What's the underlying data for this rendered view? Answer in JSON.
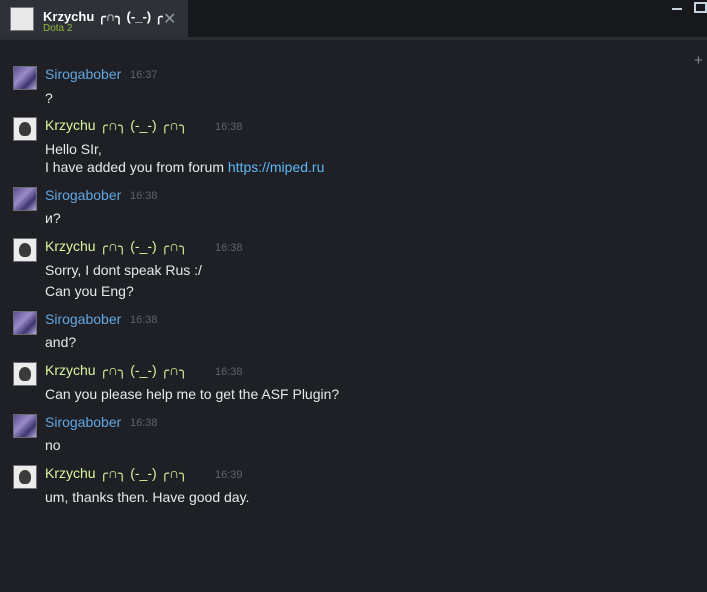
{
  "tab": {
    "name": "Krzychu  ╭∩╮ (-_-) ╭",
    "game": "Dota 2",
    "close": "✕"
  },
  "plus": "+",
  "messages": [
    {
      "sender": "Sirogabober",
      "time": "16:37",
      "lines": [
        "?"
      ]
    },
    {
      "sender": "Krzychu  ╭∩╮ (-_-) ╭∩╮",
      "time": "16:38",
      "lines": [
        "Hello SIr,",
        "I have added you from forum "
      ],
      "link": "https://miped.ru"
    },
    {
      "sender": "Sirogabober",
      "time": "16:38",
      "lines": [
        "и?"
      ]
    },
    {
      "sender": "Krzychu  ╭∩╮ (-_-) ╭∩╮",
      "time": "16:38",
      "lines": [
        "Sorry, I dont speak Rus :/",
        "Can you Eng?"
      ]
    },
    {
      "sender": "Sirogabober",
      "time": "16:38",
      "lines": [
        "and?"
      ]
    },
    {
      "sender": "Krzychu  ╭∩╮ (-_-) ╭∩╮",
      "time": "16:38",
      "lines": [
        "Can you please help me to get the ASF Plugin?"
      ]
    },
    {
      "sender": "Sirogabober",
      "time": "16:38",
      "lines": [
        "no"
      ]
    },
    {
      "sender": "Krzychu  ╭∩╮ (-_-) ╭∩╮",
      "time": "16:39",
      "lines": [
        "um, thanks then. Have good day."
      ]
    }
  ]
}
